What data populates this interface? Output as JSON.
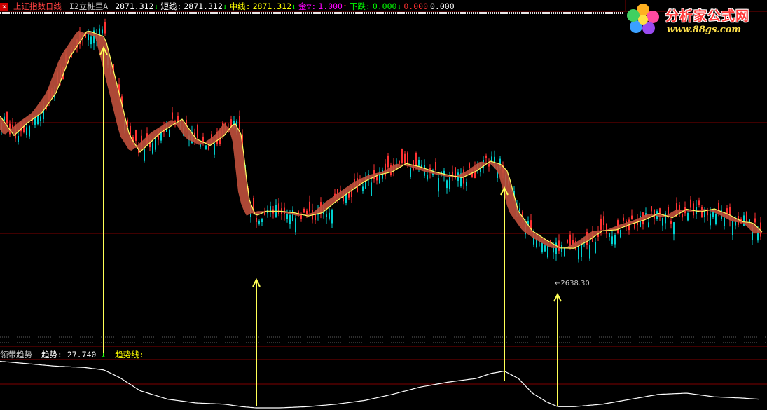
{
  "header": {
    "title": "上证指数日线",
    "indicator": "I2立桩里A",
    "items": [
      {
        "label": "2871.312",
        "color": "#ffffff",
        "arrow": "↓",
        "arrow_color": "#00ff00"
      },
      {
        "label": "短线:",
        "color": "#ffffff"
      },
      {
        "label": "2871.312",
        "color": "#ffffff",
        "arrow": "↓",
        "arrow_color": "#00ff00"
      },
      {
        "label": "中线:",
        "color": "#ffff00"
      },
      {
        "label": "2871.312",
        "color": "#ffff00",
        "arrow": "↓",
        "arrow_color": "#00ff00"
      },
      {
        "label": "金▽:",
        "color": "#ff00ff"
      },
      {
        "label": "1.000",
        "color": "#ff00ff",
        "arrow": "↑",
        "arrow_color": "#ff3030"
      },
      {
        "label": "下跌:",
        "color": "#00ff00"
      },
      {
        "label": "0.000",
        "color": "#00ff00",
        "arrow": "↓",
        "arrow_color": "#00ff00"
      },
      {
        "label": "0.000",
        "color": "#ff3030"
      },
      {
        "label": "0.000",
        "color": "#ffffff"
      }
    ],
    "close_icon": "×"
  },
  "subheader": {
    "title": "领带趋势",
    "trend_label": "趋势:",
    "trend_value": "27.740",
    "trend_arrow": "↓",
    "line_label": "趋势线:"
  },
  "logo": {
    "title": "分析家公式网",
    "url": "www.88gs.com"
  },
  "price_label": "←2638.30",
  "chart_data": [
    {
      "type": "line",
      "title": "上证指数日线",
      "series": [
        {
          "name": "中线",
          "color": "#ffff60",
          "x": [
            0,
            20,
            40,
            60,
            80,
            100,
            125,
            150,
            170,
            185,
            200,
            215,
            230,
            245,
            260,
            280,
            300,
            320,
            335,
            345,
            355,
            365,
            380,
            400,
            420,
            440,
            460,
            480,
            500,
            520,
            540,
            560,
            580,
            600,
            620,
            640,
            660,
            680,
            700,
            715,
            725,
            740,
            760,
            780,
            800,
            820,
            840,
            860,
            880,
            900,
            920,
            940,
            960,
            980,
            1000,
            1020,
            1040,
            1060,
            1075,
            1090
          ],
          "values": [
            3050,
            2990,
            3030,
            3060,
            3120,
            3230,
            3310,
            3290,
            3120,
            2990,
            2940,
            2970,
            3000,
            3020,
            3040,
            2980,
            2960,
            2990,
            3030,
            2990,
            2800,
            2745,
            2760,
            2760,
            2755,
            2745,
            2755,
            2790,
            2820,
            2850,
            2870,
            2880,
            2905,
            2895,
            2880,
            2870,
            2862,
            2882,
            2912,
            2903,
            2880,
            2760,
            2700,
            2672,
            2648,
            2647,
            2670,
            2700,
            2703,
            2720,
            2733,
            2753,
            2740,
            2766,
            2758,
            2767,
            2750,
            2728,
            2724,
            2693
          ]
        }
      ],
      "annotations": [
        "←2638.30"
      ],
      "ylim": [
        2400,
        3360
      ]
    },
    {
      "type": "line",
      "title": "领带趋势",
      "series": [
        {
          "name": "趋势线",
          "color": "#ffffff",
          "x": [
            0,
            40,
            80,
            120,
            148,
            170,
            200,
            240,
            280,
            320,
            345,
            366,
            400,
            440,
            480,
            520,
            560,
            600,
            640,
            680,
            700,
            720,
            740,
            760,
            780,
            796,
            820,
            860,
            900,
            940,
            980,
            1020,
            1060,
            1085
          ],
          "values": [
            38,
            36,
            34,
            33,
            31,
            25,
            14,
            7,
            4,
            3,
            1,
            0,
            0,
            1,
            3,
            6,
            11,
            17,
            21,
            24,
            28,
            30,
            24,
            12,
            5,
            1,
            1,
            3,
            7,
            11,
            12,
            9,
            8,
            7
          ]
        }
      ],
      "ylim": [
        0,
        40
      ]
    }
  ],
  "signal_arrows": [
    {
      "x": 148,
      "from_y": 3390,
      "to_y": 3290,
      "label": "top"
    },
    {
      "x": 366,
      "from_y": 1,
      "to_y": 2630,
      "label": "bottom"
    },
    {
      "x": 720,
      "from_y": 30,
      "to_y": 2880,
      "label": "top"
    },
    {
      "x": 796,
      "from_y": 1,
      "to_y": 2640,
      "label": "bottom"
    }
  ],
  "colors": {
    "up": "#ff3232",
    "down": "#00d0d0",
    "ribbon": "#c0503c",
    "grid_red": "#800000",
    "arrow": "#ffff55"
  }
}
